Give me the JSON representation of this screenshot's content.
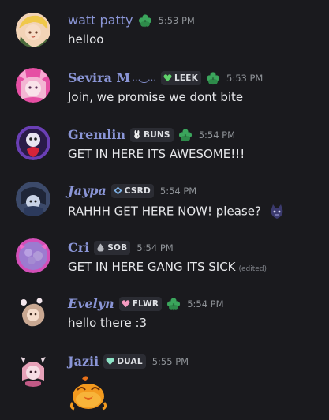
{
  "messages": [
    {
      "user": "watt patty",
      "time": "5:53 PM",
      "text": "helloo"
    },
    {
      "user": "Sevira M",
      "suffix": "…‿…",
      "tag": "LEEK",
      "time": "5:53 PM",
      "text": "Join, we promise we dont bite"
    },
    {
      "user": "Gremlin",
      "tag": "BUNS",
      "time": "5:54 PM",
      "text": "GET IN HERE ITS AWESOME!!!"
    },
    {
      "user": "Jaypa",
      "tag": "CSRD",
      "time": "5:54 PM",
      "text": "RAHHH GET HERE NOW! please?"
    },
    {
      "user": "Cri",
      "tag": "SOB",
      "time": "5:54 PM",
      "text": "GET IN HERE GANG ITS SICK",
      "edited": "(edited)"
    },
    {
      "user": "Evelyn",
      "tag": "FLWR",
      "time": "5:54 PM",
      "text": "hello there :3"
    },
    {
      "user": "Jazii",
      "tag": "DUAL",
      "time": "5:55 PM"
    }
  ],
  "colors": {
    "background": "#1a1a1e",
    "username": "#8a95d6",
    "timestamp": "#8e9297",
    "tag_bg": "#2b2c33",
    "clover": "#3ba55c"
  }
}
